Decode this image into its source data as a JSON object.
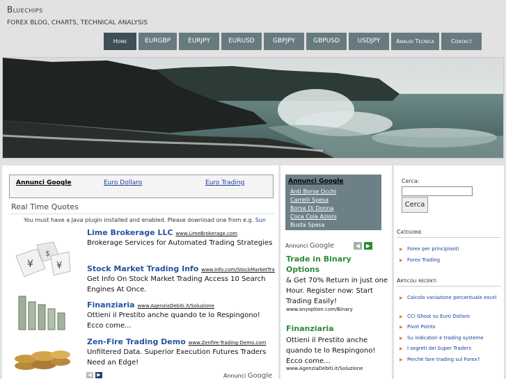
{
  "header": {
    "title": "Bluechips",
    "subtitle": "FOREX BLOG, CHARTS, TECHNICAL ANALYSIS"
  },
  "nav": [
    {
      "label": "Home",
      "width": 47
    },
    {
      "label": "EURGBP",
      "width": 55
    },
    {
      "label": "EURJPY",
      "width": 58
    },
    {
      "label": "EURUSD",
      "width": 58
    },
    {
      "label": "GBPJPY",
      "width": 58
    },
    {
      "label": "GBPUSD",
      "width": 58
    },
    {
      "label": "USDJPY",
      "width": 58
    },
    {
      "label": "Analisi Tecnica",
      "width": 69
    },
    {
      "label": "Contact",
      "width": 58
    }
  ],
  "main": {
    "ad_links": {
      "google_label": "Annunci Google",
      "link1": "Euro Dollaro",
      "link2": "Euro Trading"
    },
    "quotes_title": "Real Time Quotes",
    "java_notice": "You must have a Java plugin installed and enabled. Please download one from e.g.",
    "java_link": "Sun",
    "ads": [
      {
        "title": "Lime Brokerage LLC",
        "url": "www.LimeBrokerage.com",
        "desc": "Brokerage Services for Automated Trading Strategies"
      },
      {
        "title": "Stock Market Trading Info",
        "url": "www.Info.com/StockMarketTrad",
        "desc": "Get Info On Stock Market Trading Access 10 Search Engines At Once."
      },
      {
        "title": "Finanziaria",
        "url": "www.AgenziaDebiti.it/Soluzione",
        "desc": "Ottieni il Prestito anche quando te lo Respingono! Ecco come..."
      },
      {
        "title": "Zen-Fire Trading Demo",
        "url": "www.Zenfire-Trading-Demo.com",
        "desc": "Unfiltered Data. Superior Execution Futures Traders Need an Edge!"
      }
    ],
    "footer_brand_prefix": "Annunci",
    "footer_brand": "Google"
  },
  "mid": {
    "box": {
      "title": "Annunci Google",
      "links": [
        "Anti Borse Occhi",
        "Carrelli Spesa",
        "Borse Di Donna",
        "Coca Cola Azioni",
        "Busta Spesa"
      ]
    },
    "brand_prefix": "Annunci",
    "brand": "Google",
    "ads": [
      {
        "title": "Trade in Binary Options",
        "desc": "& Get 70% Return in just one Hour. Register now: Start Trading Easily!",
        "url": "www.anyoption.com/Binary"
      },
      {
        "title": "Finanziaria",
        "desc": "Ottieni il Prestito anche quando te lo Respingono! Ecco come...",
        "url": "www.AgenziaDebiti.it/Soluzione"
      }
    ]
  },
  "side": {
    "search_label": "Cerca:",
    "search_button": "Cerca",
    "categories_title": "Categorie",
    "categories": [
      "Forex per principianti",
      "Forex Trading"
    ],
    "recent_title": "Articoli recenti",
    "recent": [
      "Calcolo variazione percentuale excel",
      "CCI Ghost su Euro Dollaro",
      "Pivot Points",
      "Su indicatori e trading systeme",
      "I segreti dei Super Traders",
      "Perché fare trading sul Forex?"
    ]
  }
}
